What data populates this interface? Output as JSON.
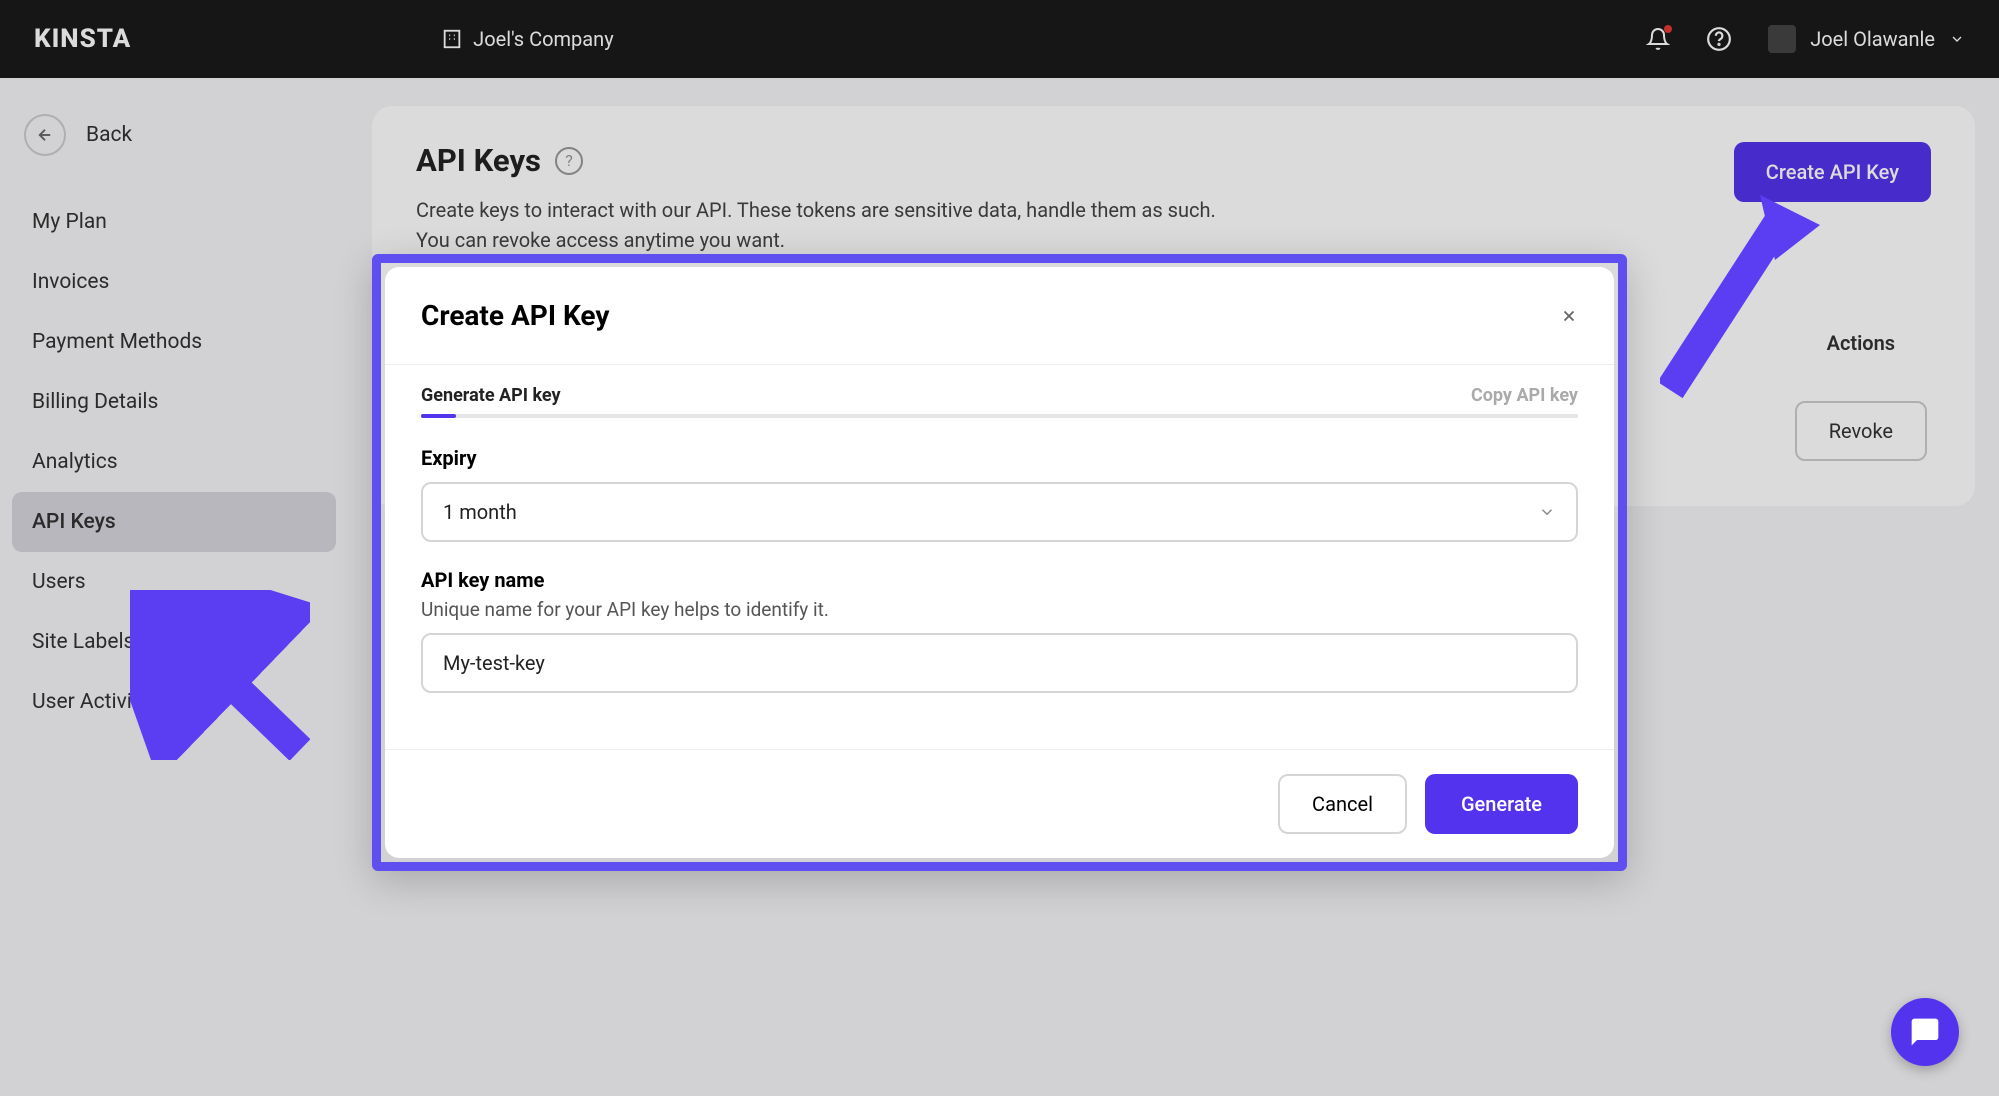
{
  "header": {
    "logo": "KINSTA",
    "company": "Joel's Company",
    "user_name": "Joel Olawanle"
  },
  "sidebar": {
    "back_label": "Back",
    "items": [
      {
        "label": "My Plan"
      },
      {
        "label": "Invoices"
      },
      {
        "label": "Payment Methods"
      },
      {
        "label": "Billing Details"
      },
      {
        "label": "Analytics"
      },
      {
        "label": "API Keys"
      },
      {
        "label": "Users"
      },
      {
        "label": "Site Labels"
      },
      {
        "label": "User Activity"
      }
    ]
  },
  "page": {
    "title": "API Keys",
    "description_line1": "Create keys to interact with our API. These tokens are sensitive data, handle them as such.",
    "description_line2": "You can revoke access anytime you want.",
    "create_button": "Create API Key",
    "actions_header": "Actions",
    "revoke_button": "Revoke"
  },
  "modal": {
    "title": "Create API Key",
    "step1": "Generate API key",
    "step2": "Copy API key",
    "expiry_label": "Expiry",
    "expiry_value": "1 month",
    "name_label": "API key name",
    "name_sublabel": "Unique name for your API key helps to identify it.",
    "name_value": "My-test-key",
    "cancel": "Cancel",
    "generate": "Generate"
  }
}
